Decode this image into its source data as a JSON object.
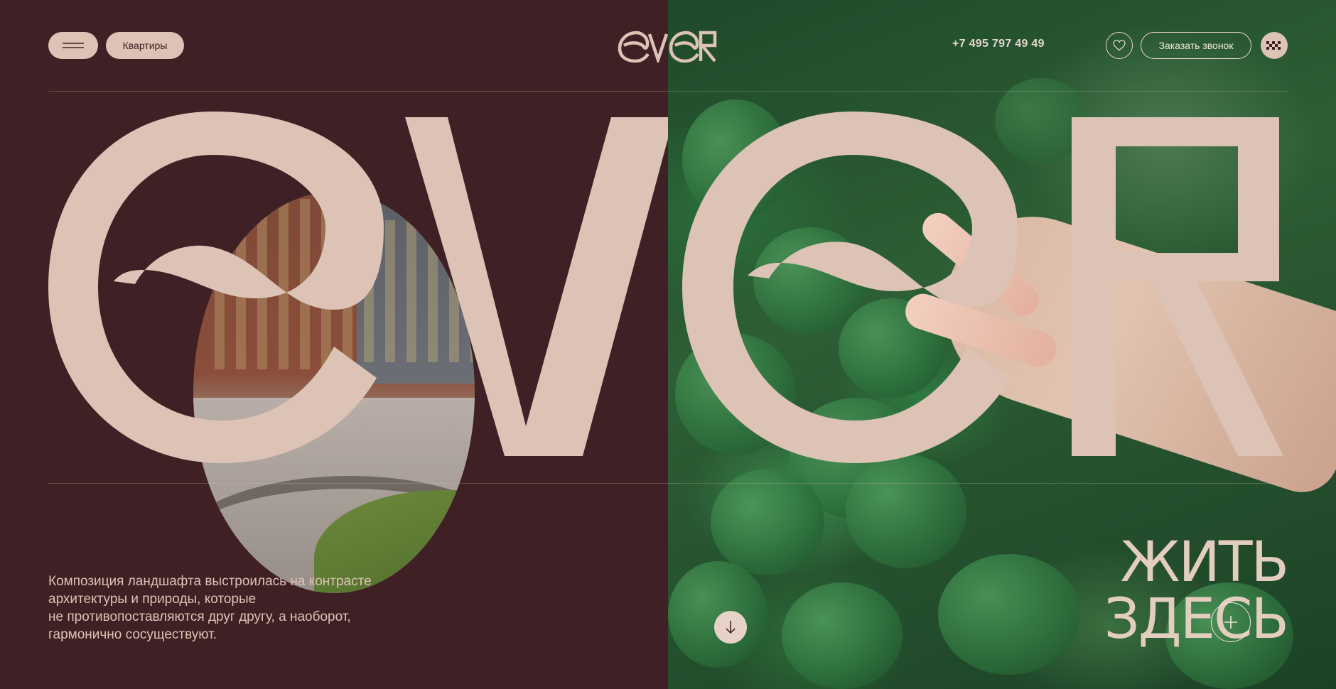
{
  "header": {
    "menu_icon": "hamburger-icon",
    "flats_label": "Квартиры",
    "logo_text": "ever",
    "phone": "+7 495 797 49 49",
    "favorites_icon": "heart-icon",
    "callback_label": "Заказать звонок",
    "taxi_icon": "checker-icon"
  },
  "hero": {
    "big_word": "ever",
    "description_lines": [
      "Композиция ландшафта выстроилась на контрасте",
      "архитектуры и природы, которые",
      "не противопоставляются друг другу, а наоборот,",
      "гармонично сосуществуют."
    ],
    "scroll_icon": "arrow-down-icon",
    "tagline_line1": "ЖИТЬ",
    "tagline_line2": "ЗДЕСЬ",
    "plus_icon": "plus-icon"
  },
  "colors": {
    "background": "#3f2024",
    "accent": "#dcc3b5",
    "text_light": "#e7d6cc"
  }
}
